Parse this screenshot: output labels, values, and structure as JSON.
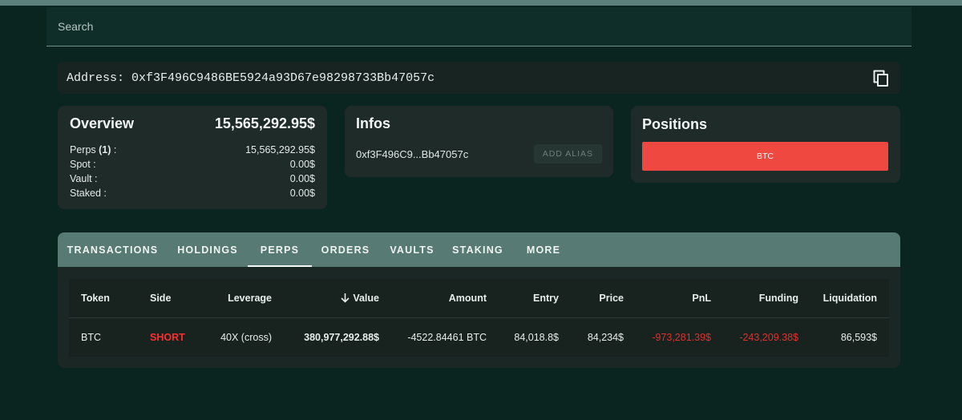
{
  "search": {
    "placeholder": "Search"
  },
  "address": {
    "label": "Address:",
    "value": "0xf3F496C9486BE5924a93D67e98298733Bb47057c",
    "copy_icon": "copy-icon"
  },
  "overview": {
    "title": "Overview",
    "total": "15,565,292.95$",
    "rows": [
      {
        "label": "Perps",
        "count": "(1)",
        "suffix": " :",
        "value": "15,565,292.95$"
      },
      {
        "label": "Spot :",
        "value": "0.00$"
      },
      {
        "label": "Vault :",
        "value": "0.00$"
      },
      {
        "label": "Staked :",
        "value": "0.00$"
      }
    ]
  },
  "infos": {
    "title": "Infos",
    "short_address": "0xf3F496C9...Bb47057c",
    "add_alias_label": "ADD ALIAS"
  },
  "positions": {
    "title": "Positions",
    "items": [
      "BTC"
    ],
    "bar_color": "#ee4840"
  },
  "tabs": [
    {
      "label": "TRANSACTIONS",
      "active": false
    },
    {
      "label": "HOLDINGS",
      "active": false
    },
    {
      "label": "PERPS",
      "active": true
    },
    {
      "label": "ORDERS",
      "active": false
    },
    {
      "label": "VAULTS",
      "active": false
    },
    {
      "label": "STAKING",
      "active": false
    },
    {
      "label": "MORE",
      "active": false
    }
  ],
  "table": {
    "headers": {
      "token": "Token",
      "side": "Side",
      "leverage": "Leverage",
      "value": "Value",
      "amount": "Amount",
      "entry": "Entry",
      "price": "Price",
      "pnl": "PnL",
      "funding": "Funding",
      "liquidation": "Liquidation"
    },
    "sort_icon": "arrow-down-icon",
    "rows": [
      {
        "token": "BTC",
        "side": "SHORT",
        "leverage": "40X (cross)",
        "value": "380,977,292.88$",
        "amount": "-4522.84461 BTC",
        "entry": "84,018.8$",
        "price": "84,234$",
        "pnl": "-973,281.39$",
        "funding": "-243,209.38$",
        "liquidation": "86,593$"
      }
    ]
  },
  "colors": {
    "background": "#0a2420",
    "tab_bar": "#587a74",
    "negative": "#e0302b",
    "short": "#ff2d2d"
  }
}
